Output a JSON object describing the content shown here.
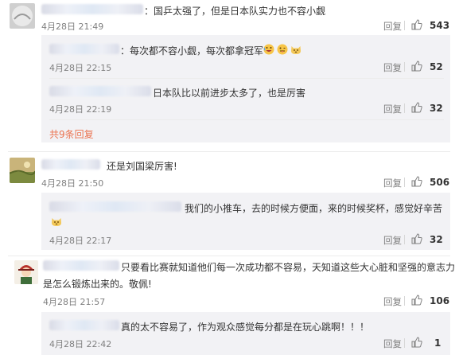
{
  "reply_label": "回复",
  "comments": [
    {
      "text": "：国乒太强了，但是日本队实力也不容小觑",
      "time": "4月28日 21:49",
      "likes": "543",
      "replies": [
        {
          "text": "：每次都不容小觑，每次都拿冠军",
          "time": "4月28日 22:15",
          "likes": "52",
          "emoji": [
            "laugh-cry-emoji",
            "tongue-emoji",
            "cat-emoji"
          ]
        },
        {
          "text": "日本队比以前进步太多了，也是厉害",
          "time": "4月28日 22:19",
          "likes": "32"
        }
      ],
      "more_link": "共9条回复"
    },
    {
      "text": "还是刘国梁厉害!",
      "time": "4月28日 21:50",
      "likes": "506",
      "replies": [
        {
          "text": "我们的小推车，去的时候方便面，来的时候奖杯，感觉好辛苦",
          "time": "4月28日 22:17",
          "likes": "32",
          "emoji": [
            "cat-emoji"
          ]
        }
      ]
    },
    {
      "text_line1": "只要看比赛就知道他们每一次成功都不容易，天知道这些大心脏和坚强的意志力",
      "text_line2": "是怎么锻炼出来的。敬佩!",
      "time": "4月28日 21:57",
      "likes": "106",
      "replies": [
        {
          "text": "真的太不容易了，作为观众感觉每分都是在玩心跳啊！！！",
          "time": "4月28日 22:42",
          "likes": "1"
        }
      ]
    }
  ],
  "colors": {
    "link": "#eb7350",
    "reply_bg": "#f2f2f5",
    "time": "#808080"
  }
}
